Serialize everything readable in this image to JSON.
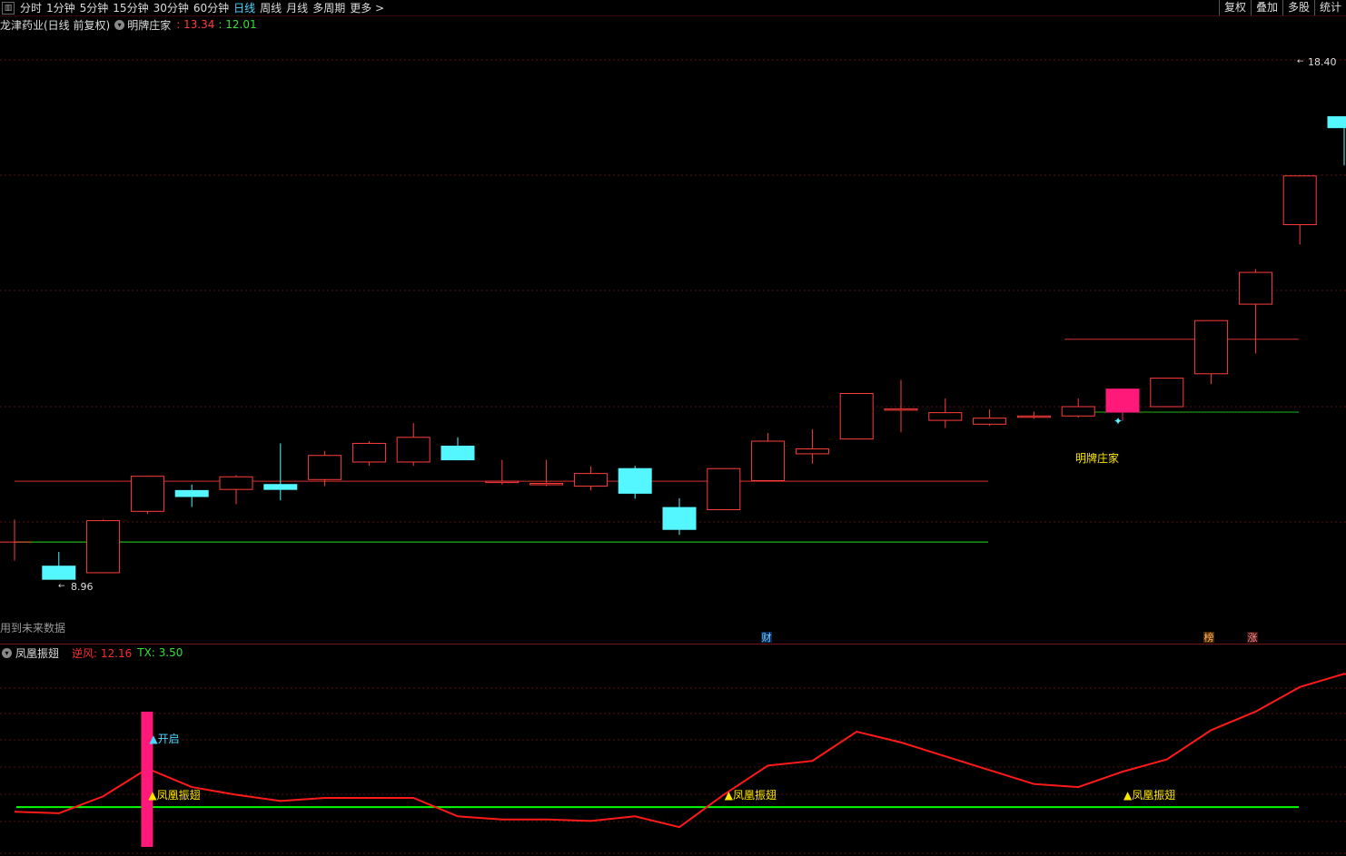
{
  "toolbar": {
    "periods": [
      "分时",
      "1分钟",
      "5分钟",
      "15分钟",
      "30分钟",
      "60分钟",
      "日线",
      "周线",
      "月线",
      "多周期",
      "更多 >"
    ],
    "active_index": 6,
    "right_buttons": [
      "复权",
      "叠加",
      "多股",
      "统计"
    ]
  },
  "info": {
    "title": "龙津药业(日线 前复权)",
    "indicator_name": "明牌庄家",
    "val_red": ": 13.34",
    "val_green": ": 12.01"
  },
  "future_label": "用到未来数据",
  "markers": {
    "cai": "财",
    "bang": "榜",
    "zhang": "涨"
  },
  "lower_panel": {
    "name": "凤凰振翅",
    "nifeng_label": "逆风: 12.16",
    "tx_label": "TX: 3.50",
    "open_label": "▲开启",
    "signal_label": "▲凤凰振翅"
  },
  "main_annotation": "明牌庄家",
  "colors": {
    "up": "#ff3c3c",
    "down": "#54f7ff",
    "hot": "#ff1a7a",
    "support": "#1fb31f",
    "resist": "#d83030",
    "grid": "#5a1010"
  },
  "chart_data": [
    {
      "type": "candlestick",
      "title": "龙津药业",
      "price_labels": {
        "high": "18.40",
        "low": "8.96"
      },
      "ohlc": [
        [
          9.64,
          10.05,
          9.3,
          9.64
        ],
        [
          9.2,
          9.46,
          8.96,
          8.96
        ],
        [
          9.08,
          10.05,
          9.08,
          10.03
        ],
        [
          10.2,
          10.84,
          10.15,
          10.84
        ],
        [
          10.58,
          10.69,
          10.28,
          10.47
        ],
        [
          10.6,
          10.86,
          10.33,
          10.83
        ],
        [
          10.69,
          11.44,
          10.4,
          10.6
        ],
        [
          10.78,
          11.3,
          10.66,
          11.22
        ],
        [
          11.1,
          11.48,
          11.03,
          11.44
        ],
        [
          11.1,
          11.81,
          11.03,
          11.55
        ],
        [
          11.39,
          11.55,
          11.13,
          11.14
        ],
        [
          10.75,
          11.14,
          10.69,
          10.75
        ],
        [
          10.71,
          11.14,
          10.66,
          10.71
        ],
        [
          10.66,
          11.02,
          10.58,
          10.89
        ],
        [
          10.98,
          11.03,
          10.43,
          10.53
        ],
        [
          10.27,
          10.44,
          9.77,
          9.87
        ],
        [
          10.23,
          10.98,
          10.23,
          10.98
        ],
        [
          10.76,
          11.63,
          10.76,
          11.48
        ],
        [
          11.25,
          11.7,
          11.07,
          11.34
        ],
        [
          11.52,
          12.35,
          11.52,
          12.35
        ],
        [
          12.07,
          12.6,
          11.64,
          12.07
        ],
        [
          11.86,
          12.26,
          11.72,
          12.0
        ],
        [
          11.79,
          12.06,
          11.76,
          11.9
        ],
        [
          11.94,
          12.02,
          11.89,
          11.94
        ],
        [
          11.94,
          12.26,
          11.91,
          12.11
        ],
        [
          12.43,
          12.43,
          11.85,
          12.01
        ],
        [
          12.11,
          12.61,
          12.11,
          12.63
        ],
        [
          12.71,
          13.34,
          12.52,
          13.68
        ],
        [
          13.98,
          14.62,
          13.08,
          14.56
        ],
        [
          15.43,
          16.32,
          15.07,
          16.32
        ],
        [
          17.4,
          17.4,
          16.51,
          17.2
        ],
        [
          17.55,
          18.4,
          16.99,
          17.7
        ]
      ],
      "support": 9.64,
      "resistance": 10.75,
      "support2": 12.01,
      "resistance2": 13.34,
      "ylim": [
        8.4,
        18.9
      ]
    },
    {
      "type": "line",
      "name": "凤凰振翅",
      "series": [
        {
          "name": "逆风",
          "values": [
            3.2,
            3.1,
            4.2,
            6.0,
            4.8,
            4.3,
            3.9,
            4.1,
            4.1,
            4.1,
            2.9,
            2.7,
            2.7,
            2.6,
            2.9,
            2.2,
            4.3,
            6.2,
            6.5,
            8.4,
            7.7,
            6.8,
            5.9,
            5.0,
            4.8,
            5.8,
            6.6,
            8.5,
            9.7,
            11.3,
            12.16,
            11.5
          ]
        },
        {
          "name": "TX",
          "values": [
            3.5,
            3.5,
            3.5,
            3.5,
            3.5,
            3.5,
            3.5,
            3.5,
            3.5,
            3.5,
            3.5,
            3.5,
            3.5,
            3.5,
            3.5,
            3.5,
            3.5,
            3.5,
            3.5,
            3.5,
            3.5,
            3.5,
            3.5,
            3.5,
            3.5,
            3.5,
            3.5,
            3.5,
            3.5,
            3.5,
            3.5,
            3.5
          ]
        }
      ],
      "signals_at": [
        3,
        16,
        25
      ],
      "open_at": 3,
      "ylim": [
        0.5,
        13
      ]
    }
  ]
}
